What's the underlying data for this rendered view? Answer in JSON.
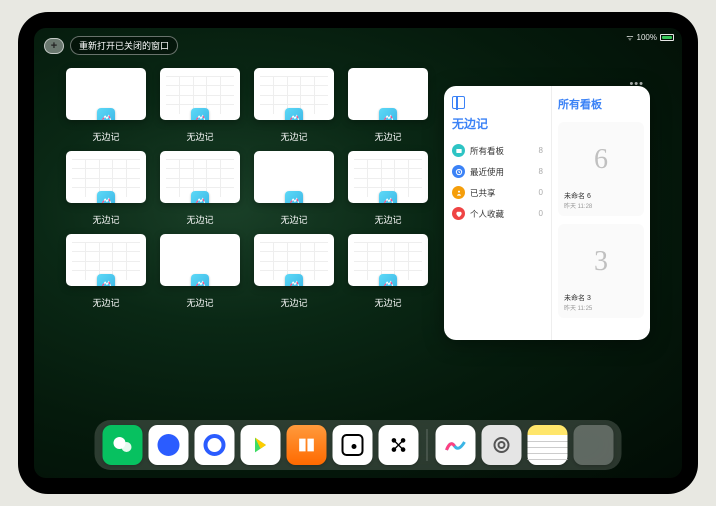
{
  "status": {
    "battery": "100%"
  },
  "topbar": {
    "reopen_label": "重新打开已关闭的窗口"
  },
  "app_name": "无边记",
  "windows": [
    {
      "label": "无边记",
      "variant": "blank"
    },
    {
      "label": "无边记",
      "variant": "cal"
    },
    {
      "label": "无边记",
      "variant": "cal"
    },
    {
      "label": "无边记",
      "variant": "blank"
    },
    {
      "label": "无边记",
      "variant": "cal"
    },
    {
      "label": "无边记",
      "variant": "cal"
    },
    {
      "label": "无边记",
      "variant": "blank"
    },
    {
      "label": "无边记",
      "variant": "cal"
    },
    {
      "label": "无边记",
      "variant": "cal"
    },
    {
      "label": "无边记",
      "variant": "blank"
    },
    {
      "label": "无边记",
      "variant": "cal"
    },
    {
      "label": "无边记",
      "variant": "cal"
    }
  ],
  "panel": {
    "left_title": "无边记",
    "right_title": "所有看板",
    "folders": [
      {
        "icon": "all",
        "color": "#2ec4c4",
        "label": "所有看板",
        "count": 8
      },
      {
        "icon": "recent",
        "color": "#3b82f6",
        "label": "最近使用",
        "count": 8
      },
      {
        "icon": "shared",
        "color": "#f59e0b",
        "label": "已共享",
        "count": 0
      },
      {
        "icon": "fav",
        "color": "#ef4444",
        "label": "个人收藏",
        "count": 0
      }
    ],
    "boards": [
      {
        "title": "未命名 6",
        "date": "昨天 11:28",
        "glyph": "6"
      },
      {
        "title": "未命名 3",
        "date": "昨天 11:25",
        "glyph": "3"
      }
    ]
  },
  "dock": [
    {
      "name": "wechat"
    },
    {
      "name": "quark-blue"
    },
    {
      "name": "quark-circle"
    },
    {
      "name": "play"
    },
    {
      "name": "books"
    },
    {
      "name": "dice"
    },
    {
      "name": "dots"
    },
    {
      "name": "freeform"
    },
    {
      "name": "settings"
    },
    {
      "name": "notes"
    },
    {
      "name": "apps"
    }
  ]
}
